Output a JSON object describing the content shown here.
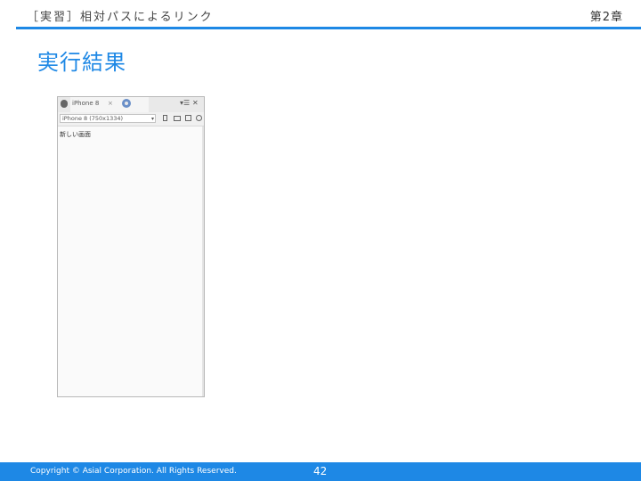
{
  "header": {
    "title": "［実習］相対パスによるリンク",
    "chapter": "第2章"
  },
  "slide": {
    "title": "実行結果"
  },
  "simulator": {
    "tab_label": "iPhone 8",
    "tab_close": "×",
    "device_select": "iPhone 8 (750x1334)",
    "select_arrow": "▾",
    "menu_glyph": "▾☰",
    "expand_glyph": "✕",
    "screen_text": "新しい画面"
  },
  "footer": {
    "copyright": "Copyright © Asial Corporation. All Rights Reserved.",
    "page_number": "42"
  },
  "colors": {
    "accent": "#1e88e5"
  }
}
